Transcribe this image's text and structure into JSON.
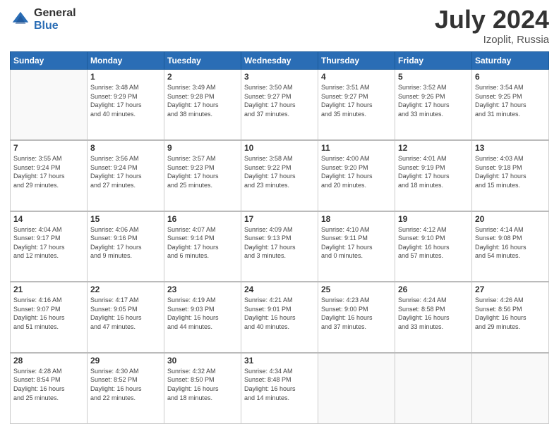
{
  "header": {
    "logo_general": "General",
    "logo_blue": "Blue",
    "title": "July 2024",
    "location": "Izoplit, Russia"
  },
  "weekdays": [
    "Sunday",
    "Monday",
    "Tuesday",
    "Wednesday",
    "Thursday",
    "Friday",
    "Saturday"
  ],
  "weeks": [
    [
      {
        "day": "",
        "info": ""
      },
      {
        "day": "1",
        "info": "Sunrise: 3:48 AM\nSunset: 9:29 PM\nDaylight: 17 hours\nand 40 minutes."
      },
      {
        "day": "2",
        "info": "Sunrise: 3:49 AM\nSunset: 9:28 PM\nDaylight: 17 hours\nand 38 minutes."
      },
      {
        "day": "3",
        "info": "Sunrise: 3:50 AM\nSunset: 9:27 PM\nDaylight: 17 hours\nand 37 minutes."
      },
      {
        "day": "4",
        "info": "Sunrise: 3:51 AM\nSunset: 9:27 PM\nDaylight: 17 hours\nand 35 minutes."
      },
      {
        "day": "5",
        "info": "Sunrise: 3:52 AM\nSunset: 9:26 PM\nDaylight: 17 hours\nand 33 minutes."
      },
      {
        "day": "6",
        "info": "Sunrise: 3:54 AM\nSunset: 9:25 PM\nDaylight: 17 hours\nand 31 minutes."
      }
    ],
    [
      {
        "day": "7",
        "info": "Sunrise: 3:55 AM\nSunset: 9:24 PM\nDaylight: 17 hours\nand 29 minutes."
      },
      {
        "day": "8",
        "info": "Sunrise: 3:56 AM\nSunset: 9:24 PM\nDaylight: 17 hours\nand 27 minutes."
      },
      {
        "day": "9",
        "info": "Sunrise: 3:57 AM\nSunset: 9:23 PM\nDaylight: 17 hours\nand 25 minutes."
      },
      {
        "day": "10",
        "info": "Sunrise: 3:58 AM\nSunset: 9:22 PM\nDaylight: 17 hours\nand 23 minutes."
      },
      {
        "day": "11",
        "info": "Sunrise: 4:00 AM\nSunset: 9:20 PM\nDaylight: 17 hours\nand 20 minutes."
      },
      {
        "day": "12",
        "info": "Sunrise: 4:01 AM\nSunset: 9:19 PM\nDaylight: 17 hours\nand 18 minutes."
      },
      {
        "day": "13",
        "info": "Sunrise: 4:03 AM\nSunset: 9:18 PM\nDaylight: 17 hours\nand 15 minutes."
      }
    ],
    [
      {
        "day": "14",
        "info": "Sunrise: 4:04 AM\nSunset: 9:17 PM\nDaylight: 17 hours\nand 12 minutes."
      },
      {
        "day": "15",
        "info": "Sunrise: 4:06 AM\nSunset: 9:16 PM\nDaylight: 17 hours\nand 9 minutes."
      },
      {
        "day": "16",
        "info": "Sunrise: 4:07 AM\nSunset: 9:14 PM\nDaylight: 17 hours\nand 6 minutes."
      },
      {
        "day": "17",
        "info": "Sunrise: 4:09 AM\nSunset: 9:13 PM\nDaylight: 17 hours\nand 3 minutes."
      },
      {
        "day": "18",
        "info": "Sunrise: 4:10 AM\nSunset: 9:11 PM\nDaylight: 17 hours\nand 0 minutes."
      },
      {
        "day": "19",
        "info": "Sunrise: 4:12 AM\nSunset: 9:10 PM\nDaylight: 16 hours\nand 57 minutes."
      },
      {
        "day": "20",
        "info": "Sunrise: 4:14 AM\nSunset: 9:08 PM\nDaylight: 16 hours\nand 54 minutes."
      }
    ],
    [
      {
        "day": "21",
        "info": "Sunrise: 4:16 AM\nSunset: 9:07 PM\nDaylight: 16 hours\nand 51 minutes."
      },
      {
        "day": "22",
        "info": "Sunrise: 4:17 AM\nSunset: 9:05 PM\nDaylight: 16 hours\nand 47 minutes."
      },
      {
        "day": "23",
        "info": "Sunrise: 4:19 AM\nSunset: 9:03 PM\nDaylight: 16 hours\nand 44 minutes."
      },
      {
        "day": "24",
        "info": "Sunrise: 4:21 AM\nSunset: 9:01 PM\nDaylight: 16 hours\nand 40 minutes."
      },
      {
        "day": "25",
        "info": "Sunrise: 4:23 AM\nSunset: 9:00 PM\nDaylight: 16 hours\nand 37 minutes."
      },
      {
        "day": "26",
        "info": "Sunrise: 4:24 AM\nSunset: 8:58 PM\nDaylight: 16 hours\nand 33 minutes."
      },
      {
        "day": "27",
        "info": "Sunrise: 4:26 AM\nSunset: 8:56 PM\nDaylight: 16 hours\nand 29 minutes."
      }
    ],
    [
      {
        "day": "28",
        "info": "Sunrise: 4:28 AM\nSunset: 8:54 PM\nDaylight: 16 hours\nand 25 minutes."
      },
      {
        "day": "29",
        "info": "Sunrise: 4:30 AM\nSunset: 8:52 PM\nDaylight: 16 hours\nand 22 minutes."
      },
      {
        "day": "30",
        "info": "Sunrise: 4:32 AM\nSunset: 8:50 PM\nDaylight: 16 hours\nand 18 minutes."
      },
      {
        "day": "31",
        "info": "Sunrise: 4:34 AM\nSunset: 8:48 PM\nDaylight: 16 hours\nand 14 minutes."
      },
      {
        "day": "",
        "info": ""
      },
      {
        "day": "",
        "info": ""
      },
      {
        "day": "",
        "info": ""
      }
    ]
  ]
}
